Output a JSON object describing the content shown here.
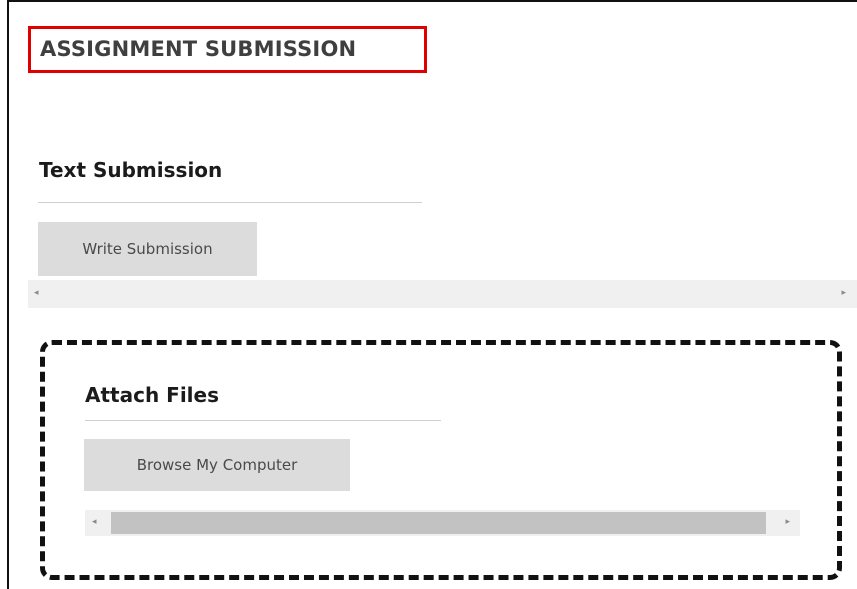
{
  "page": {
    "title": "ASSIGNMENT SUBMISSION"
  },
  "text_submission": {
    "heading": "Text Submission",
    "button_label": "Write Submission"
  },
  "attach_files": {
    "heading": "Attach Files",
    "button_label": "Browse My Computer"
  },
  "scrollbars": {
    "left_arrow": "◂",
    "right_arrow": "▸"
  },
  "colors": {
    "title_highlight": "#e00000",
    "button_bg": "#dcdcdc",
    "scrollbar_track": "#f0f0f0",
    "scrollbar_thumb": "#c2c2c2"
  }
}
